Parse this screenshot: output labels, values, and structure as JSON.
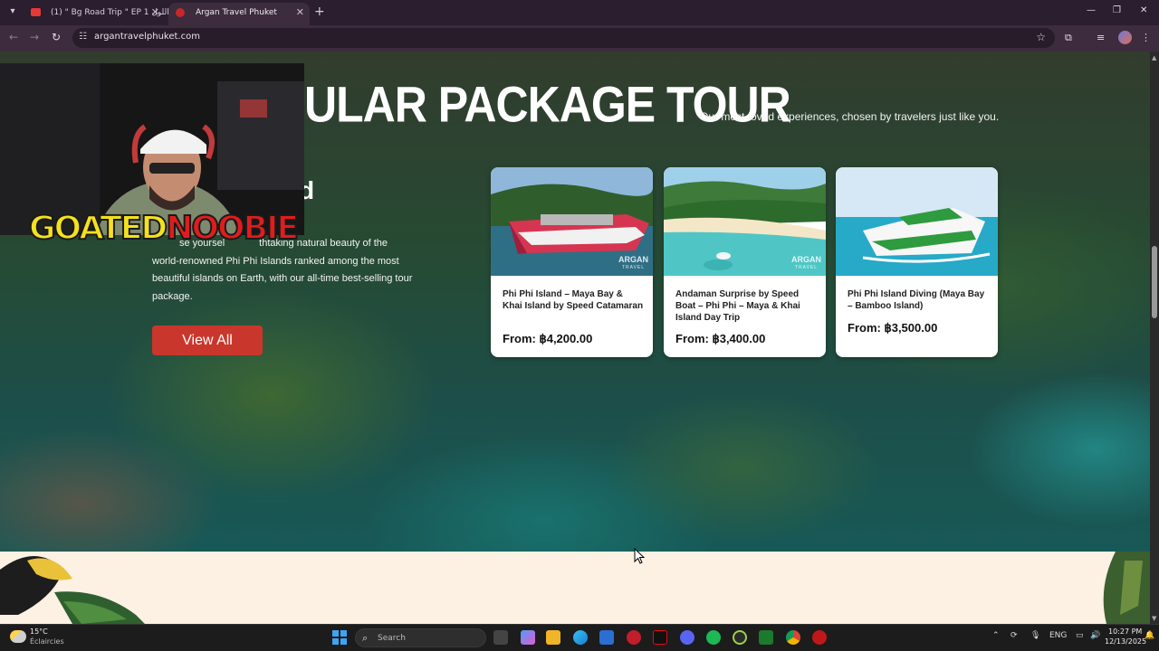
{
  "browser": {
    "tabs": [
      {
        "label": "(1) \" Bg Road Trip \" EP 1 اللول |",
        "active": false
      },
      {
        "label": "Argan Travel Phuket",
        "active": true
      }
    ],
    "url": "argantravelphuket.com"
  },
  "hero": {
    "title": "ULAR PACKAGE TOUR",
    "subtitle": "Our most-loved experiences, chosen by travelers just like you.",
    "heading_fragment": "d",
    "description_lines": [
      "thtaking natural beauty of the",
      "world-renowned Phi Phi Islands ranked among the most",
      "beautiful islands on Earth, with our all-time best-selling tour",
      "package."
    ],
    "description_partial_prefix": "se yoursel",
    "view_all_label": "View All"
  },
  "cards": [
    {
      "title": "Phi Phi Island – Maya Bay & Khai Island by Speed Catamaran",
      "price": "From: ฿4,200.00",
      "brand": "ARGAN",
      "brand_sub": "TRAVEL"
    },
    {
      "title": "Andaman Surprise by Speed Boat – Phi Phi – Maya & Khai Island Day Trip",
      "price": "From: ฿3,400.00",
      "brand": "ARGAN",
      "brand_sub": "TRAVEL"
    },
    {
      "title": "Phi Phi Island Diving (Maya Bay – Bamboo Island)",
      "price": "From: ฿3,500.00",
      "brand": "",
      "brand_sub": ""
    }
  ],
  "overlay": {
    "logo_part1": "GOATED",
    "logo_part2": "NOOBIE"
  },
  "taskbar": {
    "weather_temp": "15°C",
    "weather_desc": "Éclaircies",
    "search_placeholder": "Search",
    "lang": "ENG",
    "time": "10:27 PM",
    "date": "12/13/2025"
  },
  "colors": {
    "accent_button": "#c9372c",
    "chrome_bg": "#3c2c3d",
    "lower_section_bg": "#fcf1e3"
  }
}
